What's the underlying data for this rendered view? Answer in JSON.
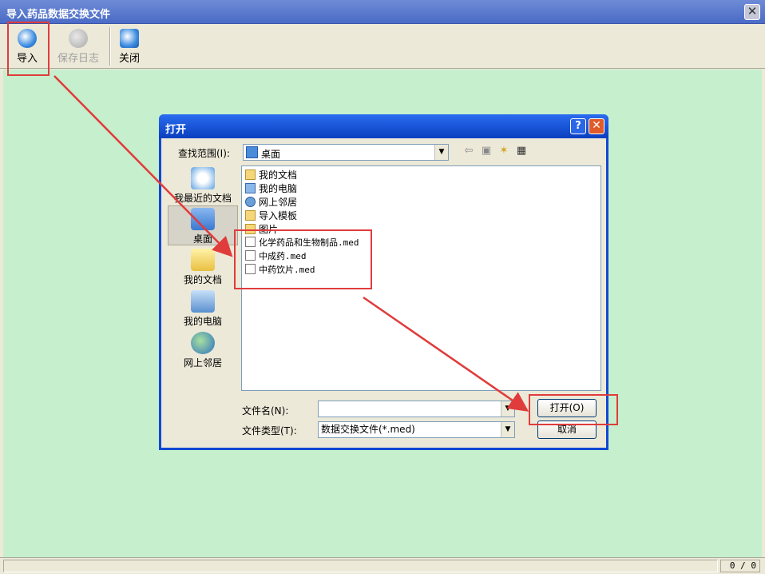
{
  "window": {
    "title": "导入药品数据交换文件"
  },
  "toolbar": {
    "import_label": "导入",
    "save_log_label": "保存日志",
    "close_label": "关闭"
  },
  "status": {
    "count": "0 / 0"
  },
  "dialog": {
    "title": "打开",
    "help": "?",
    "lookin_label": "查找范围(I):",
    "lookin_value": "桌面",
    "places": [
      "我最近的文档",
      "桌面",
      "我的文档",
      "我的电脑",
      "网上邻居"
    ],
    "files": [
      {
        "name": "我的文档",
        "kind": "folder"
      },
      {
        "name": "我的电脑",
        "kind": "computer"
      },
      {
        "name": "网上邻居",
        "kind": "network"
      },
      {
        "name": "导入模板",
        "kind": "folder"
      },
      {
        "name": "图片",
        "kind": "folder"
      },
      {
        "name": "化学药品和生物制品.med",
        "kind": "file"
      },
      {
        "name": "中成药.med",
        "kind": "file"
      },
      {
        "name": "中药饮片.med",
        "kind": "file"
      }
    ],
    "filename_label": "文件名(N):",
    "filename_value": "",
    "filetype_label": "文件类型(T):",
    "filetype_value": "数据交换文件(*.med)",
    "open_button": "打开(O)",
    "cancel_button": "取消"
  },
  "colors": {
    "annotation": "#e03c3c",
    "workarea": "#c5efcd",
    "titlebar": "#4a6bc6"
  }
}
